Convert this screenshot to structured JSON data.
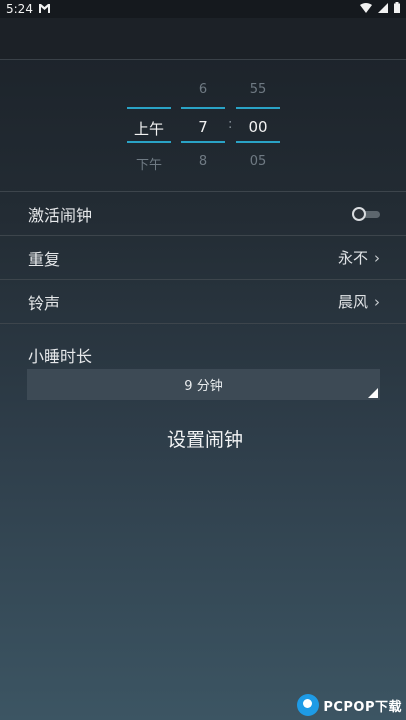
{
  "status_bar": {
    "time": "5:24",
    "notif_icon": "gmail-icon",
    "icons": [
      "wifi-icon",
      "signal-icon",
      "battery-icon"
    ]
  },
  "time_picker": {
    "period": {
      "prev": "",
      "selected": "上午",
      "next": "下午"
    },
    "hour": {
      "prev": "6",
      "selected": "7",
      "next": "8"
    },
    "separator": ":",
    "minute": {
      "prev": "55",
      "selected": "00",
      "next": "05"
    }
  },
  "settings": {
    "activate": {
      "label": "激活闹钟",
      "enabled": false
    },
    "repeat": {
      "label": "重复",
      "value": "永不"
    },
    "ringtone": {
      "label": "铃声",
      "value": "晨风"
    }
  },
  "snooze": {
    "label": "小睡时长",
    "value": "9 分钟"
  },
  "set_alarm_label": "设置闹钟",
  "watermark": "PCPOP下载",
  "colors": {
    "accent": "#2aa3c6",
    "background_top": "#1b2128",
    "background_bottom": "#3c5563"
  }
}
